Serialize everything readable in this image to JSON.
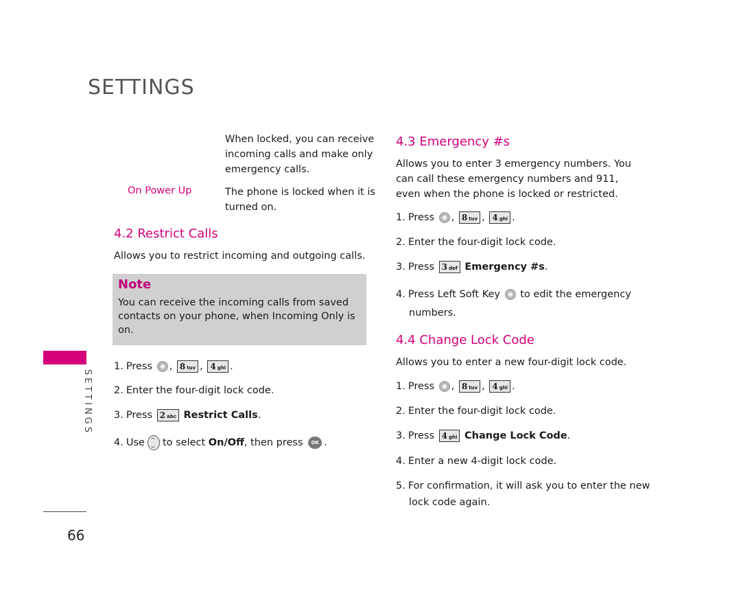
{
  "header": {
    "title": "SETTINGS"
  },
  "sidebar": {
    "label": "SETTINGS",
    "accent_color": "#d4007a"
  },
  "page_number": "66",
  "left_column": {
    "continued_definition": "When locked, you can receive incoming calls and make only emergency calls.",
    "definition": {
      "term": "On Power Up",
      "description": "The phone is locked when it is turned on."
    },
    "section_4_2": {
      "heading": "4.2 Restrict Calls",
      "intro": "Allows you to restrict incoming and outgoing calls.",
      "note": {
        "title": "Note",
        "body": "You can receive the incoming calls from saved contacts on your phone, when Incoming Only is on."
      },
      "steps": [
        {
          "num": "1.",
          "text": "Press",
          "keys": [
            "menu-key",
            "8 tuv",
            "4 ghi"
          ]
        },
        {
          "num": "2.",
          "text": "Enter the four-digit lock code."
        },
        {
          "num": "3.",
          "text": "Press",
          "key": "2 abc",
          "bold": "Restrict Calls",
          "end": "."
        },
        {
          "num": "4.",
          "pre": "Use",
          "mid": "to select",
          "bold": "On/Off",
          "post": ", then press",
          "ok": "OK",
          "end": "."
        }
      ]
    }
  },
  "right_column": {
    "section_4_3": {
      "heading": "4.3 Emergency #s",
      "intro": "Allows you to enter 3 emergency numbers. You can call these emergency numbers and 911, even when the phone is locked or restricted.",
      "steps": [
        {
          "num": "1.",
          "text": "Press"
        },
        {
          "num": "2.",
          "text": "Enter the four-digit lock code."
        },
        {
          "num": "3.",
          "text": "Press",
          "key": "3 def",
          "bold": "Emergency #s",
          "end": "."
        },
        {
          "num": "4.",
          "text": "Press Left Soft Key",
          "post": "to edit the emergency",
          "cont": "numbers."
        }
      ]
    },
    "section_4_4": {
      "heading": "4.4 Change Lock Code",
      "intro": "Allows you to enter a new four-digit lock code.",
      "steps": [
        {
          "num": "1.",
          "text": "Press"
        },
        {
          "num": "2.",
          "text": "Enter the four-digit lock code."
        },
        {
          "num": "3.",
          "text": "Press",
          "key": "4 ghi",
          "bold": "Change Lock Code",
          "end": "."
        },
        {
          "num": "4.",
          "text": "Enter a new 4-digit lock code."
        },
        {
          "num": "5.",
          "text": "For confirmation, it will ask you to enter the new",
          "cont": "lock code again."
        }
      ]
    }
  },
  "keys": {
    "k8": {
      "digit": "8",
      "letters": "tuv"
    },
    "k4": {
      "digit": "4",
      "letters": "ghi"
    },
    "k2": {
      "digit": "2",
      "letters": "abc"
    },
    "k3": {
      "digit": "3",
      "letters": "def"
    },
    "ok": "OK",
    "comma": ",",
    "period": "."
  }
}
